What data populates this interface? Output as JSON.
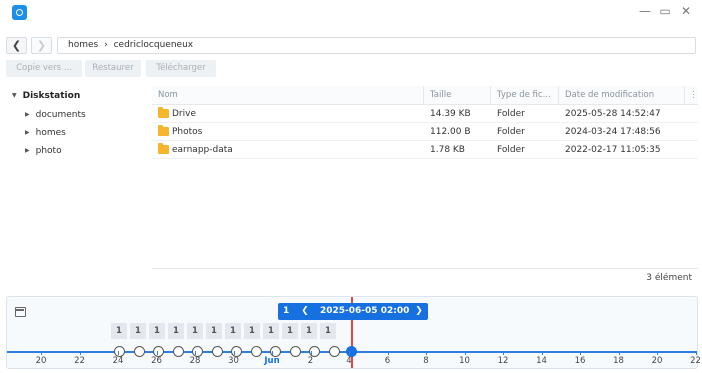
{
  "window": {
    "minimize_glyph": "—",
    "maximize_glyph": "▭",
    "close_glyph": "✕"
  },
  "nav": {
    "back_glyph": "❮",
    "forward_glyph": "❯",
    "breadcrumb": [
      "homes",
      "cedriclocqueneux"
    ],
    "separator": "›"
  },
  "toolbar": {
    "copy_label": "Copie vers ...",
    "restore_label": "Restaurer",
    "download_label": "Télécharger"
  },
  "tree": {
    "root": "Diskstation",
    "items": [
      "documents",
      "homes",
      "photo"
    ]
  },
  "table": {
    "columns": [
      "Nom",
      "Taille",
      "Type de fic...",
      "Date de modification"
    ],
    "rows": [
      {
        "name": "Drive",
        "size": "14.39 KB",
        "type": "Folder",
        "modified": "2025-05-28 14:52:47"
      },
      {
        "name": "Photos",
        "size": "112.00 B",
        "type": "Folder",
        "modified": "2024-03-24 17:48:56"
      },
      {
        "name": "earnapp-data",
        "size": "1.78 KB",
        "type": "Folder",
        "modified": "2022-02-17 11:05:35"
      }
    ],
    "item_count": "3 élément"
  },
  "timeline": {
    "snapshot_count": "1",
    "current_datetime": "2025-06-05 02:00",
    "prev_glyph": "❮",
    "next_glyph": "❯",
    "day_counts": [
      "1",
      "1",
      "1",
      "1",
      "1",
      "1",
      "1",
      "1",
      "1",
      "1",
      "1",
      "1"
    ],
    "axis_labels": [
      "20",
      "22",
      "24",
      "26",
      "28",
      "30",
      "Jun",
      "2",
      "4",
      "6",
      "8",
      "10",
      "12",
      "14",
      "16",
      "18",
      "20",
      "22"
    ],
    "month_label": "Jun",
    "accent_color": "#1670e0",
    "cursor_color": "#e04848"
  }
}
